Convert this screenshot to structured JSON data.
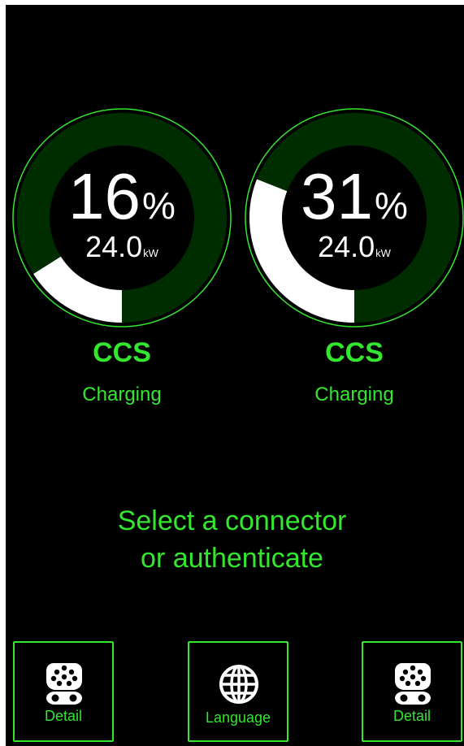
{
  "connectors": [
    {
      "percent": "16",
      "percent_unit": "%",
      "power": "24.0",
      "power_unit": "kW",
      "progress": 0.16,
      "type": "CCS",
      "status": "Charging"
    },
    {
      "percent": "31",
      "percent_unit": "%",
      "power": "24.0",
      "power_unit": "kW",
      "progress": 0.31,
      "type": "CCS",
      "status": "Charging"
    }
  ],
  "prompt": {
    "line1": "Select a connector",
    "line2": "or authenticate"
  },
  "buttons": {
    "left_label": "Detail",
    "language_label": "Language",
    "right_label": "Detail"
  },
  "colors": {
    "accent": "#33e62e",
    "ring_track": "#002d00",
    "progress": "#ffffff",
    "background": "#000000"
  },
  "icons": {
    "detail": "ev-connector-icon",
    "language": "globe-icon"
  }
}
